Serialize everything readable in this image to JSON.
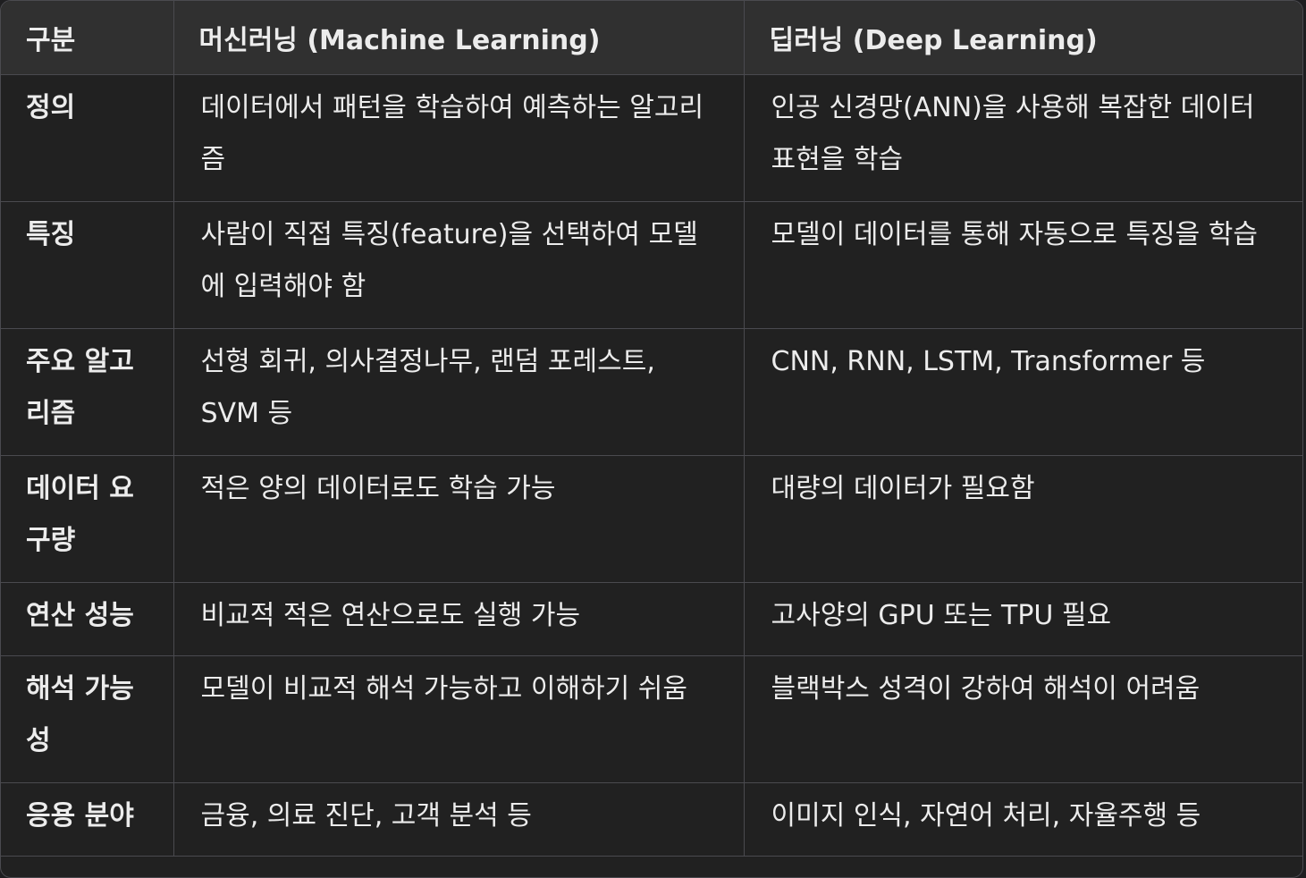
{
  "table": {
    "headers": [
      "구분",
      "머신러닝 (Machine Learning)",
      "딥러닝 (Deep Learning)"
    ],
    "rows": [
      [
        "정의",
        "데이터에서 패턴을 학습하여 예측하는 알고리즘",
        "인공 신경망(ANN)을 사용해 복잡한 데이터 표현을 학습"
      ],
      [
        "특징",
        "사람이 직접 특징(feature)을 선택하여 모델에 입력해야 함",
        "모델이 데이터를 통해 자동으로 특징을 학습"
      ],
      [
        "주요 알고리즘",
        "선형 회귀, 의사결정나무, 랜덤 포레스트, SVM 등",
        "CNN, RNN, LSTM, Transformer 등"
      ],
      [
        "데이터 요구량",
        "적은 양의 데이터로도 학습 가능",
        "대량의 데이터가 필요함"
      ],
      [
        "연산 성능",
        "비교적 적은 연산으로도 실행 가능",
        "고사양의 GPU 또는 TPU 필요"
      ],
      [
        "해석 가능성",
        "모델이 비교적 해석 가능하고 이해하기 쉬움",
        "블랙박스 성격이 강하여 해석이 어려움"
      ],
      [
        "응용 분야",
        "금융, 의료 진단, 고객 분석 등",
        "이미지 인식, 자연어 처리, 자율주행 등"
      ]
    ]
  }
}
